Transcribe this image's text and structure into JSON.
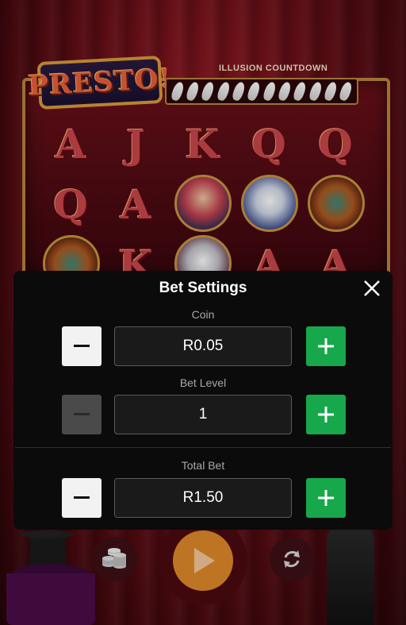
{
  "game": {
    "logo_text": "PRESTO!",
    "countdown_label": "ILLUSION COUNTDOWN",
    "feather_count": 12,
    "reels": {
      "row1": [
        "A",
        "J",
        "K",
        "Q",
        "Q"
      ],
      "row2": [
        "Q",
        "A",
        "lady-symbol",
        "rabbit-symbol",
        "box-symbol"
      ],
      "row3": [
        "box-symbol",
        "K",
        "dove-symbol",
        "A",
        "A"
      ]
    }
  },
  "bet_settings": {
    "title": "Bet Settings",
    "coin": {
      "label": "Coin",
      "value": "R0.05"
    },
    "bet_level": {
      "label": "Bet Level",
      "value": "1"
    },
    "total_bet": {
      "label": "Total Bet",
      "value": "R1.50"
    }
  },
  "colors": {
    "plus_green": "#16a84a",
    "spin_orange": "#e08a2a",
    "modal_bg": "#0b0b0b"
  },
  "icons": {
    "close": "close-icon",
    "minus": "minus-icon",
    "plus": "plus-icon",
    "spin": "play-icon",
    "coins": "coin-stack-icon",
    "autoplay": "refresh-icon"
  }
}
